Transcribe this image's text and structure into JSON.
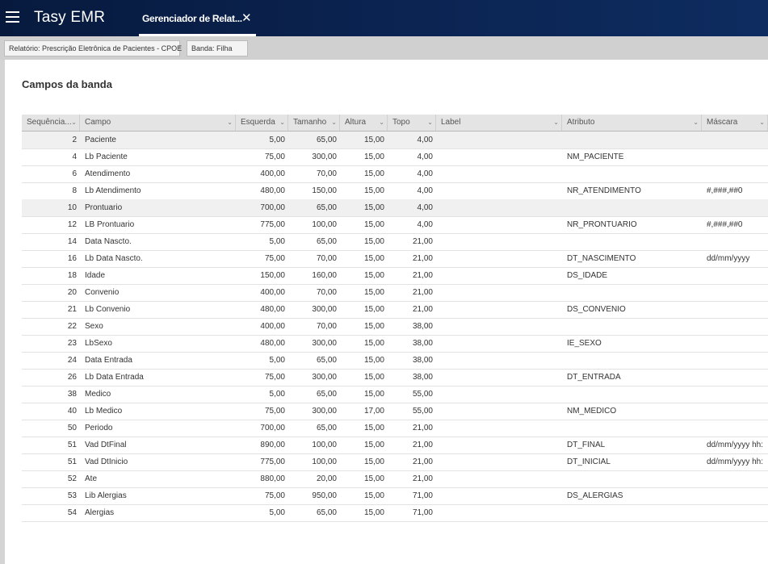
{
  "app": {
    "title": "Tasy EMR"
  },
  "tab": {
    "label": "Gerenciador de Relat...",
    "close_icon": "close-icon"
  },
  "breadcrumb": {
    "report_label": "Relatório:",
    "report_value": "Prescrição Eletrônica de Pacientes - CPOE",
    "band_label": "Banda:",
    "band_value": "Filha"
  },
  "section": {
    "title": "Campos da banda"
  },
  "columns": [
    "Sequência...",
    "Campo",
    "Esquerda",
    "Tamanho",
    "Altura",
    "Topo",
    "Label",
    "Atributo",
    "Máscara"
  ],
  "rows": [
    {
      "seq": "2",
      "campo": "Paciente",
      "esq": "5,00",
      "tam": "65,00",
      "alt": "15,00",
      "topo": "4,00",
      "label": "",
      "attr": "",
      "mask": ""
    },
    {
      "seq": "4",
      "campo": "Lb Paciente",
      "esq": "75,00",
      "tam": "300,00",
      "alt": "15,00",
      "topo": "4,00",
      "label": "",
      "attr": "NM_PACIENTE",
      "mask": ""
    },
    {
      "seq": "6",
      "campo": "Atendimento",
      "esq": "400,00",
      "tam": "70,00",
      "alt": "15,00",
      "topo": "4,00",
      "label": "",
      "attr": "",
      "mask": ""
    },
    {
      "seq": "8",
      "campo": "Lb Atendimento",
      "esq": "480,00",
      "tam": "150,00",
      "alt": "15,00",
      "topo": "4,00",
      "label": "",
      "attr": "NR_ATENDIMENTO",
      "mask": "#,###,##0"
    },
    {
      "seq": "10",
      "campo": "Prontuario",
      "esq": "700,00",
      "tam": "65,00",
      "alt": "15,00",
      "topo": "4,00",
      "label": "",
      "attr": "",
      "mask": ""
    },
    {
      "seq": "12",
      "campo": "LB Prontuario",
      "esq": "775,00",
      "tam": "100,00",
      "alt": "15,00",
      "topo": "4,00",
      "label": "",
      "attr": "NR_PRONTUARIO",
      "mask": "#,###,##0"
    },
    {
      "seq": "14",
      "campo": "Data Nascto.",
      "esq": "5,00",
      "tam": "65,00",
      "alt": "15,00",
      "topo": "21,00",
      "label": "",
      "attr": "",
      "mask": ""
    },
    {
      "seq": "16",
      "campo": "Lb Data Nascto.",
      "esq": "75,00",
      "tam": "70,00",
      "alt": "15,00",
      "topo": "21,00",
      "label": "",
      "attr": "DT_NASCIMENTO",
      "mask": "dd/mm/yyyy"
    },
    {
      "seq": "18",
      "campo": "Idade",
      "esq": "150,00",
      "tam": "160,00",
      "alt": "15,00",
      "topo": "21,00",
      "label": "",
      "attr": "DS_IDADE",
      "mask": ""
    },
    {
      "seq": "20",
      "campo": "Convenio",
      "esq": "400,00",
      "tam": "70,00",
      "alt": "15,00",
      "topo": "21,00",
      "label": "",
      "attr": "",
      "mask": ""
    },
    {
      "seq": "21",
      "campo": "Lb Convenio",
      "esq": "480,00",
      "tam": "300,00",
      "alt": "15,00",
      "topo": "21,00",
      "label": "",
      "attr": "DS_CONVENIO",
      "mask": ""
    },
    {
      "seq": "22",
      "campo": "Sexo",
      "esq": "400,00",
      "tam": "70,00",
      "alt": "15,00",
      "topo": "38,00",
      "label": "",
      "attr": "",
      "mask": ""
    },
    {
      "seq": "23",
      "campo": "LbSexo",
      "esq": "480,00",
      "tam": "300,00",
      "alt": "15,00",
      "topo": "38,00",
      "label": "",
      "attr": "IE_SEXO",
      "mask": ""
    },
    {
      "seq": "24",
      "campo": "Data Entrada",
      "esq": "5,00",
      "tam": "65,00",
      "alt": "15,00",
      "topo": "38,00",
      "label": "",
      "attr": "",
      "mask": ""
    },
    {
      "seq": "26",
      "campo": "Lb Data Entrada",
      "esq": "75,00",
      "tam": "300,00",
      "alt": "15,00",
      "topo": "38,00",
      "label": "",
      "attr": "DT_ENTRADA",
      "mask": ""
    },
    {
      "seq": "38",
      "campo": "Medico",
      "esq": "5,00",
      "tam": "65,00",
      "alt": "15,00",
      "topo": "55,00",
      "label": "",
      "attr": "",
      "mask": ""
    },
    {
      "seq": "40",
      "campo": "Lb Medico",
      "esq": "75,00",
      "tam": "300,00",
      "alt": "17,00",
      "topo": "55,00",
      "label": "",
      "attr": "NM_MEDICO",
      "mask": ""
    },
    {
      "seq": "50",
      "campo": "Periodo",
      "esq": "700,00",
      "tam": "65,00",
      "alt": "15,00",
      "topo": "21,00",
      "label": "",
      "attr": "",
      "mask": ""
    },
    {
      "seq": "51",
      "campo": "Vad DtFinal",
      "esq": "890,00",
      "tam": "100,00",
      "alt": "15,00",
      "topo": "21,00",
      "label": "",
      "attr": "DT_FINAL",
      "mask": "dd/mm/yyyy hh:"
    },
    {
      "seq": "51",
      "campo": "Vad DtInicio",
      "esq": "775,00",
      "tam": "100,00",
      "alt": "15,00",
      "topo": "21,00",
      "label": "",
      "attr": "DT_INICIAL",
      "mask": "dd/mm/yyyy hh:"
    },
    {
      "seq": "52",
      "campo": "Ate",
      "esq": "880,00",
      "tam": "20,00",
      "alt": "15,00",
      "topo": "21,00",
      "label": "",
      "attr": "",
      "mask": ""
    },
    {
      "seq": "53",
      "campo": "Lib Alergias",
      "esq": "75,00",
      "tam": "950,00",
      "alt": "15,00",
      "topo": "71,00",
      "label": "",
      "attr": "DS_ALERGIAS",
      "mask": ""
    },
    {
      "seq": "54",
      "campo": "Alergias",
      "esq": "5,00",
      "tam": "65,00",
      "alt": "15,00",
      "topo": "71,00",
      "label": "",
      "attr": "",
      "mask": ""
    }
  ],
  "highlighted_rows": [
    0,
    4
  ]
}
